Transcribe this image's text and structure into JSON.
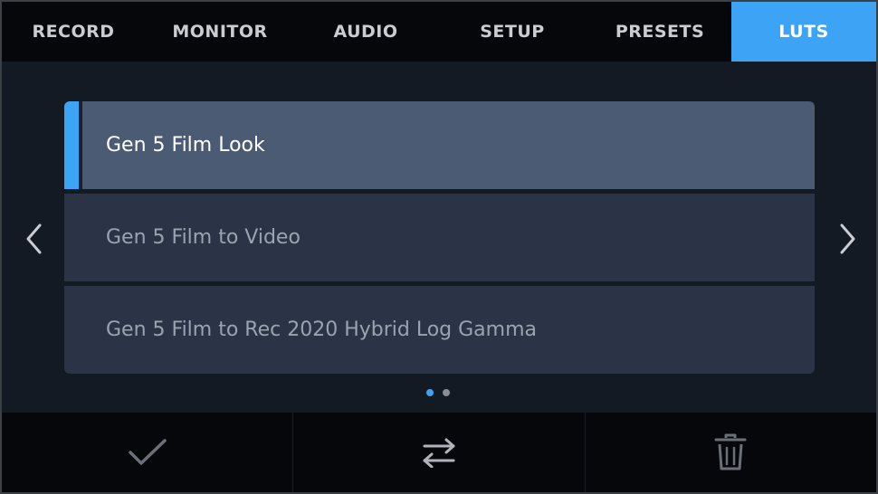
{
  "tabs": [
    {
      "label": "RECORD",
      "active": false
    },
    {
      "label": "MONITOR",
      "active": false
    },
    {
      "label": "AUDIO",
      "active": false
    },
    {
      "label": "SETUP",
      "active": false
    },
    {
      "label": "PRESETS",
      "active": false
    },
    {
      "label": "LUTS",
      "active": true
    }
  ],
  "luts": [
    {
      "label": "Gen 5 Film Look",
      "selected": true
    },
    {
      "label": "Gen 5 Film to Video",
      "selected": false
    },
    {
      "label": "Gen 5 Film to Rec 2020 Hybrid Log Gamma",
      "selected": false
    }
  ],
  "pagination": {
    "total": 2,
    "current": 1
  },
  "icons": {
    "prev": "chevron-left-icon",
    "next": "chevron-right-icon",
    "apply": "checkmark-icon",
    "transfer": "swap-arrows-icon",
    "delete": "trash-icon"
  },
  "colors": {
    "accent": "#3da3f5",
    "selected_row": "#4c5b74",
    "row": "#2b3446"
  }
}
